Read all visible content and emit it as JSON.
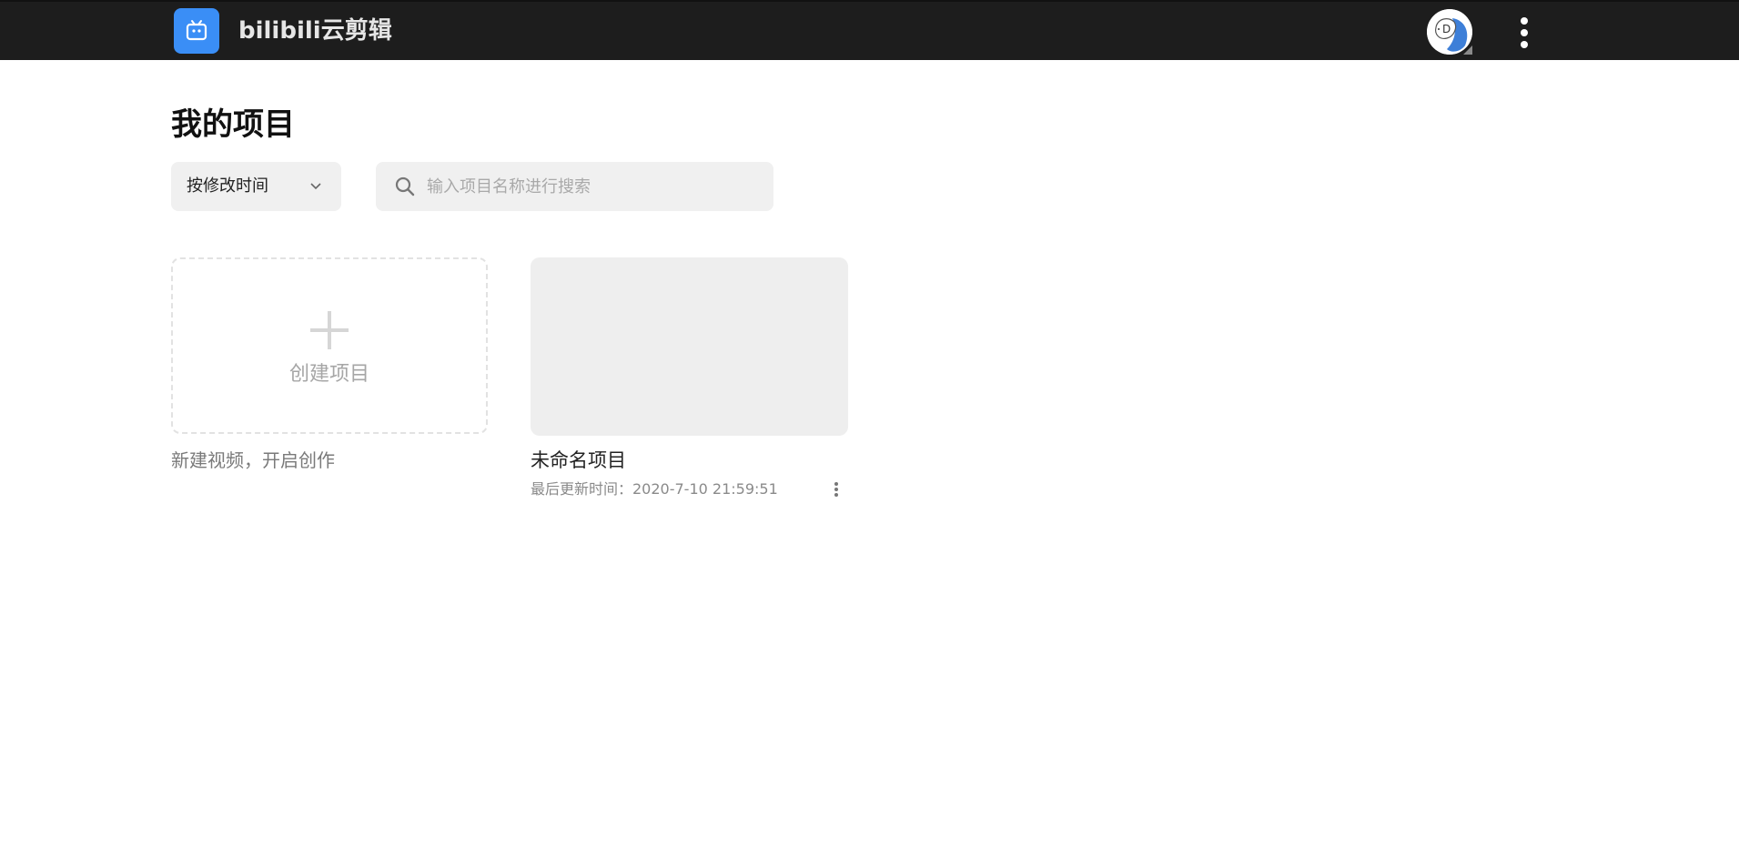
{
  "header": {
    "brand": "bilibili云剪辑",
    "logo_icon": "bilibili-tv-icon",
    "avatar_icon": "user-avatar",
    "menu_icon": "more-vertical-icon"
  },
  "main": {
    "title": "我的项目",
    "sort": {
      "selected": "按修改时间",
      "icon": "chevron-down-icon"
    },
    "search": {
      "placeholder": "输入项目名称进行搜索",
      "value": "",
      "icon": "search-icon"
    },
    "create_card": {
      "label": "创建项目",
      "description": "新建视频，开启创作",
      "icon": "plus-icon"
    },
    "projects": [
      {
        "name": "未命名项目",
        "updated_label": "最后更新时间：2020-7-10 21:59:51",
        "menu_icon": "more-vertical-icon"
      }
    ]
  },
  "colors": {
    "topbar_bg": "#1d1d1d",
    "logo_bg": "#3a8ef6",
    "input_bg": "#f0f0f0",
    "thumb_bg": "#eeeeee"
  }
}
